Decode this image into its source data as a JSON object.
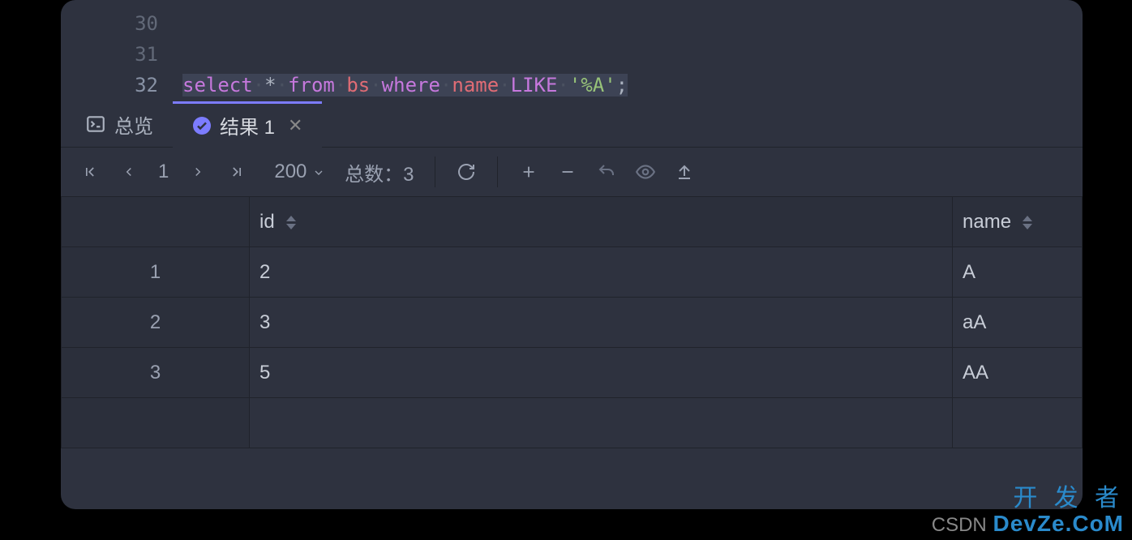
{
  "editor": {
    "lines": [
      {
        "num": "30"
      },
      {
        "num": "31"
      },
      {
        "num": "32",
        "active": true
      }
    ],
    "sql": {
      "select": "select",
      "star": "*",
      "from": "from",
      "table": "bs",
      "where": "where",
      "col": "name",
      "like": "LIKE",
      "literal": "'%A'",
      "semi": ";"
    }
  },
  "tabs": {
    "overview": "总览",
    "result": "结果 1"
  },
  "toolbar": {
    "page": "1",
    "page_size": "200",
    "total_label": "总数：",
    "total_value": "3"
  },
  "table": {
    "columns": [
      "id",
      "name"
    ],
    "rows": [
      {
        "n": "1",
        "id": "2",
        "name": "A"
      },
      {
        "n": "2",
        "id": "3",
        "name": "aA"
      },
      {
        "n": "3",
        "id": "5",
        "name": "AA"
      }
    ]
  },
  "watermark": {
    "csdn": "CSDN",
    "cn": "开 发 者",
    "en": "DevZe.CoM"
  }
}
